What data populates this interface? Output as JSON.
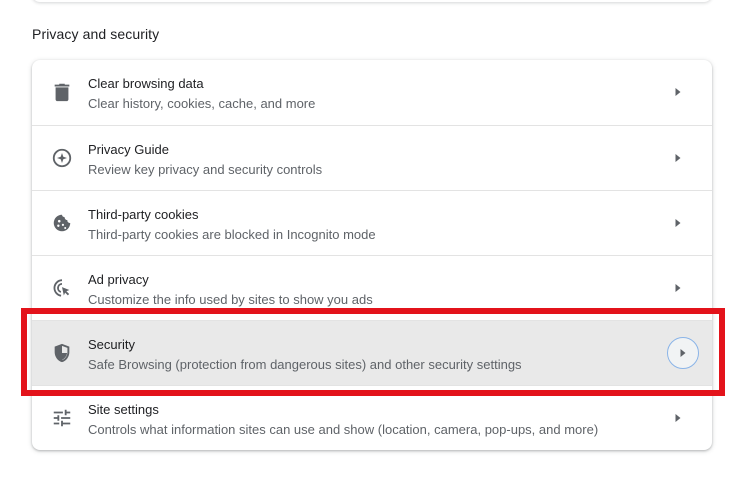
{
  "section": {
    "title": "Privacy and security"
  },
  "items": [
    {
      "label": "Clear browsing data",
      "sublabel": "Clear history, cookies, cache, and more",
      "icon": "trash-icon"
    },
    {
      "label": "Privacy Guide",
      "sublabel": "Review key privacy and security controls",
      "icon": "privacy-guide-icon"
    },
    {
      "label": "Third-party cookies",
      "sublabel": "Third-party cookies are blocked in Incognito mode",
      "icon": "cookie-icon"
    },
    {
      "label": "Ad privacy",
      "sublabel": "Customize the info used by sites to show you ads",
      "icon": "ad-privacy-icon"
    },
    {
      "label": "Security",
      "sublabel": "Safe Browsing (protection from dangerous sites) and other security settings",
      "icon": "shield-icon"
    },
    {
      "label": "Site settings",
      "sublabel": "Controls what information sites can use and show (location, camera, pop-ups, and more)",
      "icon": "tune-icon"
    }
  ],
  "colors": {
    "highlight": "#e3131b",
    "active_row": "#e9e9e9",
    "focus_ring": "#8ab4e8",
    "icon": "#5f6368"
  }
}
